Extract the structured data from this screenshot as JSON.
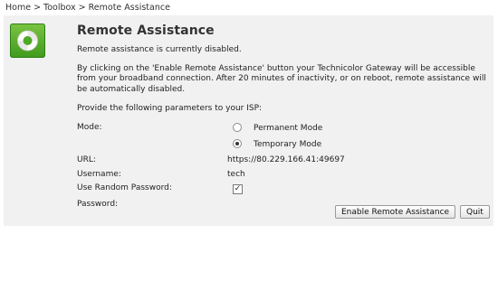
{
  "breadcrumb": {
    "home": "Home",
    "toolbox": "Toolbox",
    "current": "Remote Assistance",
    "separator": ">"
  },
  "page": {
    "title": "Remote Assistance",
    "status": "Remote assistance is currently disabled.",
    "description": "By clicking on the 'Enable Remote Assistance' button your Technicolor Gateway will be accessible from your broadband connection. After 20 minutes of inactivity, or on reboot, remote assistance will be automatically disabled.",
    "instructions": "Provide the following parameters to your ISP:"
  },
  "form": {
    "mode_label": "Mode:",
    "mode_options": [
      {
        "label": "Permanent Mode",
        "selected": false
      },
      {
        "label": "Temporary Mode",
        "selected": true
      }
    ],
    "url_label": "URL:",
    "url_value": "https://80.229.166.41:49697",
    "username_label": "Username:",
    "username_value": "tech",
    "random_password_label": "Use Random Password:",
    "random_password_checked": true,
    "password_label": "Password:",
    "password_value": ""
  },
  "actions": {
    "enable_label": "Enable Remote Assistance",
    "quit_label": "Quit"
  },
  "icons": {
    "logo": "lifebuoy-icon"
  },
  "colors": {
    "logo_green": "#4faa26",
    "panel_bg": "#f1f1f1"
  }
}
